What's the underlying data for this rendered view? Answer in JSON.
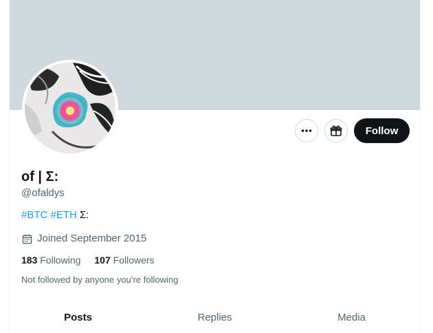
{
  "profile": {
    "display_name": "of | Σ:",
    "handle": "@ofaldys",
    "bio_tags": [
      "#BTC",
      "#ETH"
    ],
    "bio_suffix": "Σ:",
    "joined": "Joined September 2015",
    "following_count": "183",
    "following_label": "Following",
    "followers_count": "107",
    "followers_label": "Followers",
    "not_followed_text": "Not followed by anyone you’re following"
  },
  "actions": {
    "more_icon": "more-horizontal-icon",
    "gift_icon": "gift-icon",
    "follow_label": "Follow"
  },
  "tabs": [
    {
      "label": "Posts",
      "active": true
    },
    {
      "label": "Replies",
      "active": false
    },
    {
      "label": "Media",
      "active": false
    }
  ],
  "colors": {
    "banner": "#cfd9de",
    "link": "#1d9bf0",
    "follow_bg": "#0f1419",
    "secondary_text": "#536471"
  }
}
